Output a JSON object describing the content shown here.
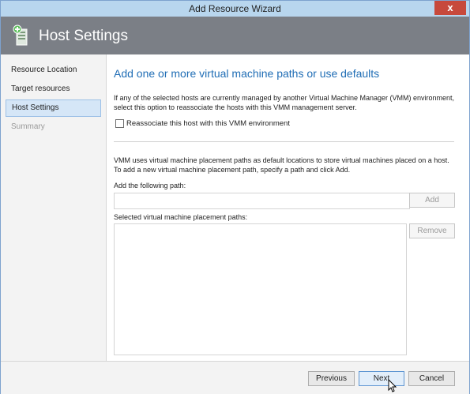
{
  "window": {
    "title": "Add Resource Wizard",
    "close_glyph": "x"
  },
  "header": {
    "title": "Host Settings",
    "icon": "server-settings-icon"
  },
  "nav": {
    "items": [
      {
        "label": "Resource Location",
        "state": "normal"
      },
      {
        "label": "Target resources",
        "state": "normal"
      },
      {
        "label": "Host Settings",
        "state": "active"
      },
      {
        "label": "Summary",
        "state": "disabled"
      }
    ]
  },
  "main": {
    "heading": "Add one or more virtual machine paths or use defaults",
    "reassociate_text": "If any of the selected hosts are currently managed by another Virtual Machine Manager (VMM) environment, select this option to reassociate the hosts with this VMM management server.",
    "reassociate_checkbox": {
      "label": "Reassociate this host with this VMM environment",
      "checked": false
    },
    "paths_text": "VMM uses virtual machine placement paths as default locations to store virtual machines placed on a host. To add a new virtual machine placement path, specify a path and click Add.",
    "add_path_label": "Add the following path:",
    "add_path_value": "",
    "add_button": "Add",
    "selected_paths_label": "Selected virtual machine placement paths:",
    "selected_paths": [],
    "remove_button": "Remove"
  },
  "footer": {
    "previous": "Previous",
    "next": "Next",
    "cancel": "Cancel"
  },
  "colors": {
    "accent": "#1f6db5",
    "header_bg": "#7b7f86",
    "close_red": "#c7493c"
  }
}
